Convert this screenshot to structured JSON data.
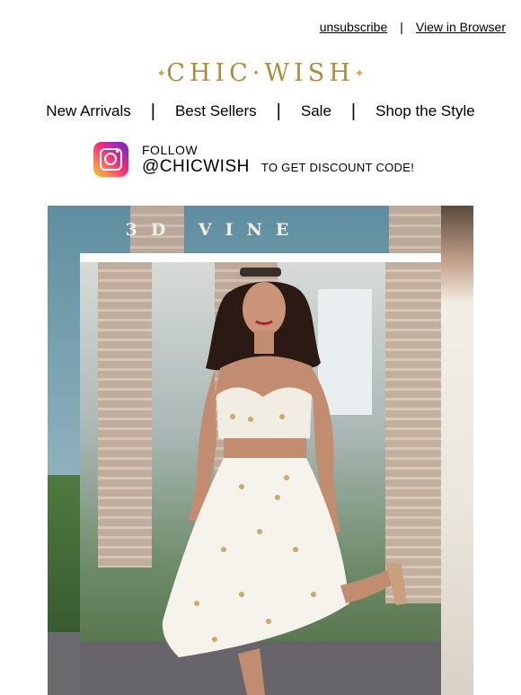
{
  "header": {
    "unsubscribe": "unsubscribe",
    "separator": "|",
    "view_in_browser": "View in Browser"
  },
  "logo": {
    "text": "CHIC·WISH",
    "brand_color": "#b08a3e"
  },
  "nav": {
    "items": [
      {
        "label": "New Arrivals"
      },
      {
        "label": "Best Sellers"
      },
      {
        "label": "Sale"
      },
      {
        "label": "Shop the Style"
      }
    ],
    "separator": "|"
  },
  "instagram": {
    "icon": "instagram-icon",
    "line1": "FOLLOW",
    "handle": "@CHICWISH",
    "cta": "TO GET DISCOUNT CODE!"
  },
  "hero": {
    "title": "3D VINE",
    "image": "model-in-embroidered-crop-top-and-tulle-skirt"
  }
}
